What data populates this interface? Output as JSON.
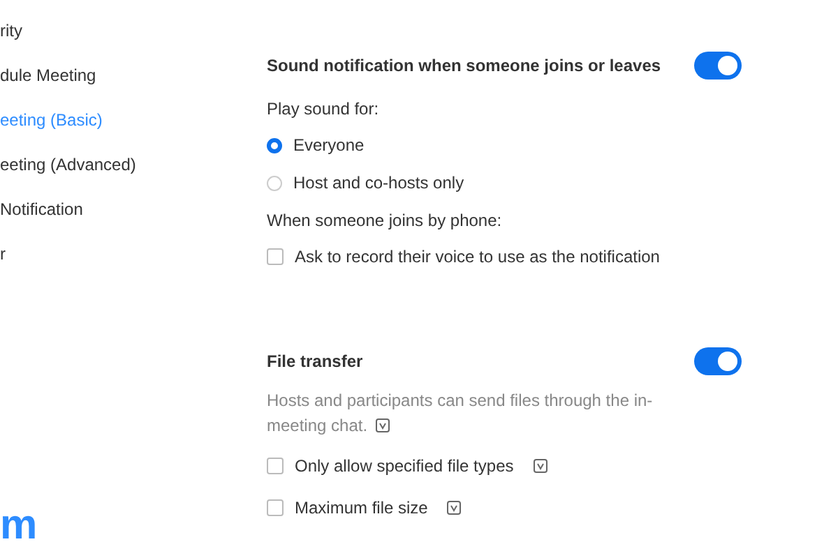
{
  "sidebar": {
    "items": [
      {
        "label": "rity",
        "selected": false
      },
      {
        "label": "dule Meeting",
        "selected": false
      },
      {
        "label": "eeting (Basic)",
        "selected": true
      },
      {
        "label": "eeting (Advanced)",
        "selected": false
      },
      {
        "label": "Notification",
        "selected": false
      },
      {
        "label": "r",
        "selected": false
      }
    ],
    "logo": "m"
  },
  "settings": [
    {
      "title": "Sound notification when someone joins or leaves",
      "on": true,
      "items": [
        {
          "kind": "label",
          "text": "Play sound for:"
        },
        {
          "kind": "radio",
          "text": "Everyone",
          "selected": true
        },
        {
          "kind": "radio",
          "text": "Host and co-hosts only",
          "selected": false
        },
        {
          "kind": "label",
          "text": "When someone joins by phone:"
        },
        {
          "kind": "checkbox",
          "text": "Ask to record their voice to use as the notification",
          "checked": false,
          "info": false
        }
      ]
    },
    {
      "title": "File transfer",
      "on": true,
      "description": "Hosts and participants can send files through the in-meeting chat.",
      "items": [
        {
          "kind": "checkbox",
          "text": "Only allow specified file types",
          "checked": false,
          "info": true
        },
        {
          "kind": "checkbox",
          "text": "Maximum file size",
          "checked": false,
          "info": true
        }
      ]
    }
  ]
}
